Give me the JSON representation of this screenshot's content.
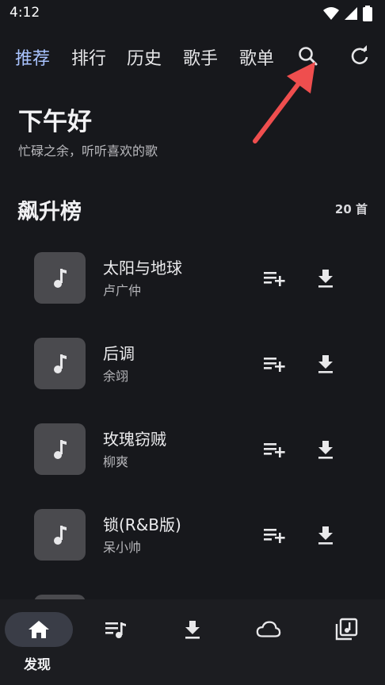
{
  "status_bar": {
    "time": "4:12",
    "icons": [
      "wifi-icon",
      "signal-icon",
      "battery-icon"
    ]
  },
  "top_nav": {
    "tabs": [
      {
        "label": "推荐",
        "active": true
      },
      {
        "label": "排行",
        "active": false
      },
      {
        "label": "历史",
        "active": false
      },
      {
        "label": "歌手",
        "active": false
      },
      {
        "label": "歌单",
        "active": false
      }
    ],
    "icons": [
      "search-icon",
      "refresh-icon"
    ]
  },
  "greeting": {
    "title": "下午好",
    "subtitle": "忙碌之余，听听喜欢的歌"
  },
  "section": {
    "title": "飙升榜",
    "count": "20 首"
  },
  "songs": [
    {
      "title": "太阳与地球",
      "artist": "卢广仲"
    },
    {
      "title": "后调",
      "artist": "余翊"
    },
    {
      "title": "玫瑰窃贼",
      "artist": "柳爽"
    },
    {
      "title": "锁(R&B版)",
      "artist": "呆小帅"
    },
    {
      "title": "",
      "artist": ""
    }
  ],
  "bottom_nav": {
    "items": [
      {
        "icon": "home-icon",
        "label": "发现",
        "active": true
      },
      {
        "icon": "playlist-icon",
        "label": "",
        "active": false
      },
      {
        "icon": "download-icon",
        "label": "",
        "active": false
      },
      {
        "icon": "cloud-icon",
        "label": "",
        "active": false
      },
      {
        "icon": "library-icon",
        "label": "",
        "active": false
      }
    ]
  },
  "colors": {
    "background": "#17181c",
    "accent": "#a9c3ff",
    "annotation": "#ef4e4e",
    "cover": "#4a4a4e",
    "nav_pill": "#3a3d47"
  }
}
